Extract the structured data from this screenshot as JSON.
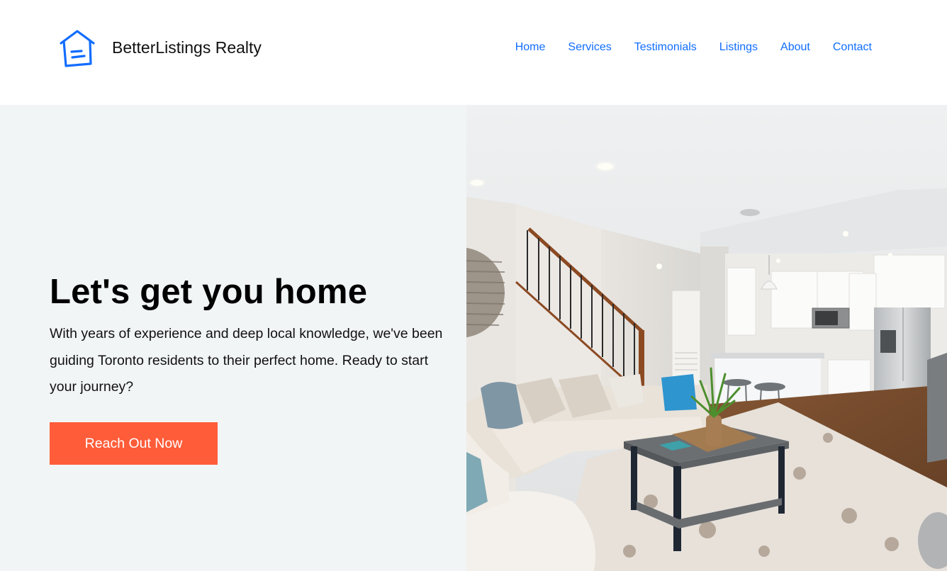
{
  "header": {
    "logo_icon": "house-logo-icon",
    "brand_name": "BetterListings Realty",
    "nav": [
      {
        "label": "Home"
      },
      {
        "label": "Services"
      },
      {
        "label": "Testimonials"
      },
      {
        "label": "Listings"
      },
      {
        "label": "About"
      },
      {
        "label": "Contact"
      }
    ]
  },
  "hero": {
    "title": "Let's get you home",
    "description": "With years of experience and deep local knowledge, we've been guiding Toronto residents to their perfect home. Ready to start your journey?",
    "cta_label": "Reach Out Now",
    "image_alt": "Bright living room with sectional sofa, coffee table and open kitchen"
  },
  "colors": {
    "accent_link": "#116dff",
    "cta": "#ff5c39",
    "hero_bg": "#f2f5f6"
  }
}
